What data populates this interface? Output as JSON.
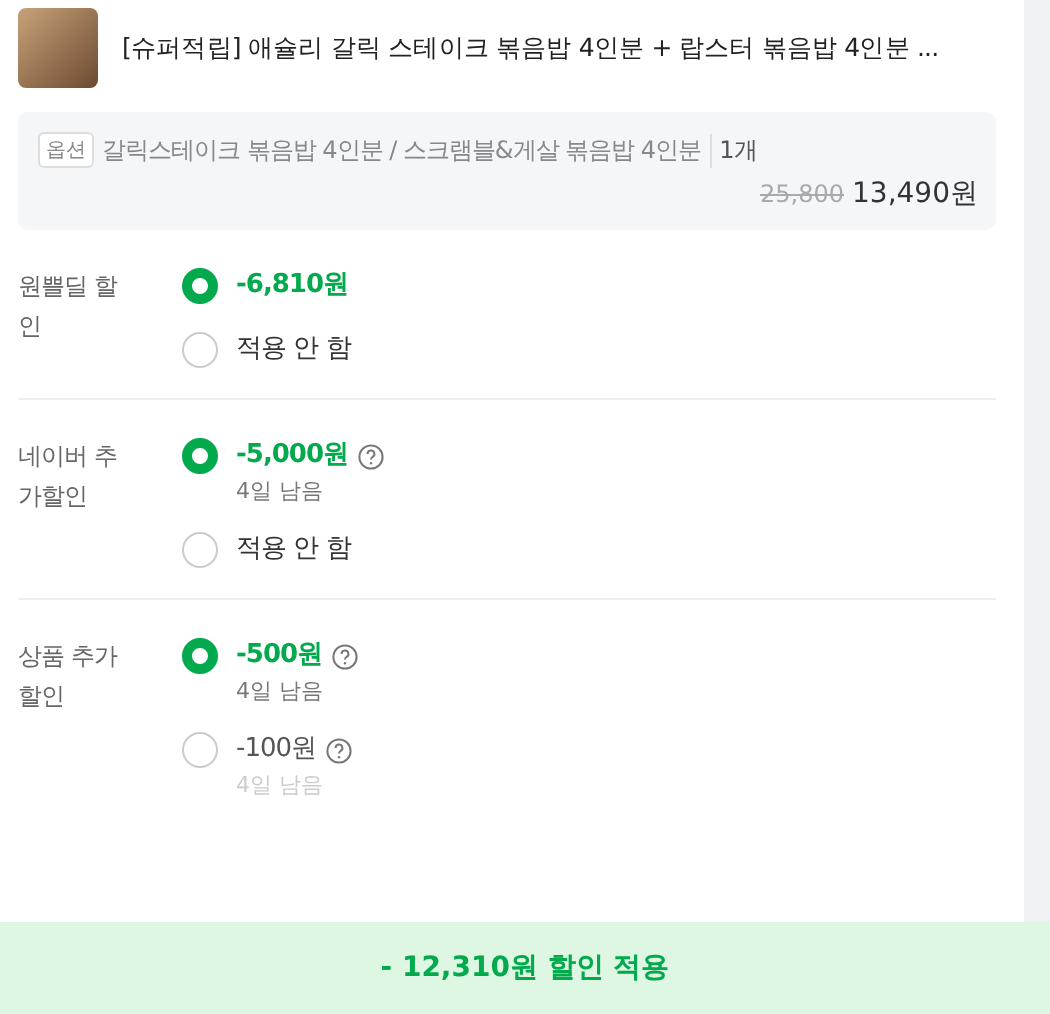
{
  "product": {
    "title": "[슈퍼적립] 애슐리 갈릭 스테이크 볶음밥 4인분 + 랍스터 볶음밥 4인분 ..."
  },
  "option": {
    "badge": "옵션",
    "text": "갈릭스테이크 볶음밥 4인분 / 스크램블&게살 볶음밥 4인분",
    "quantity": "1개",
    "original_price": "25,800",
    "price": "13,490원"
  },
  "discounts": [
    {
      "label": "원쁠딜 할인",
      "options": [
        {
          "text": "-6,810원",
          "selected": true,
          "help": false
        },
        {
          "text": "적용 안 함",
          "selected": false,
          "help": false
        }
      ]
    },
    {
      "label": "네이버 추가할인",
      "options": [
        {
          "text": "-5,000원",
          "note": "4일 남음",
          "selected": true,
          "help": true
        },
        {
          "text": "적용 안 함",
          "selected": false,
          "help": false
        }
      ]
    },
    {
      "label": "상품 추가할인",
      "options": [
        {
          "text": "-500원",
          "note": "4일 남음",
          "selected": true,
          "help": true
        },
        {
          "text": "-100원",
          "note": "4일 남음",
          "selected": false,
          "help": true,
          "faded": true
        }
      ]
    }
  ],
  "apply_button": "- 12,310원 할인 적용"
}
